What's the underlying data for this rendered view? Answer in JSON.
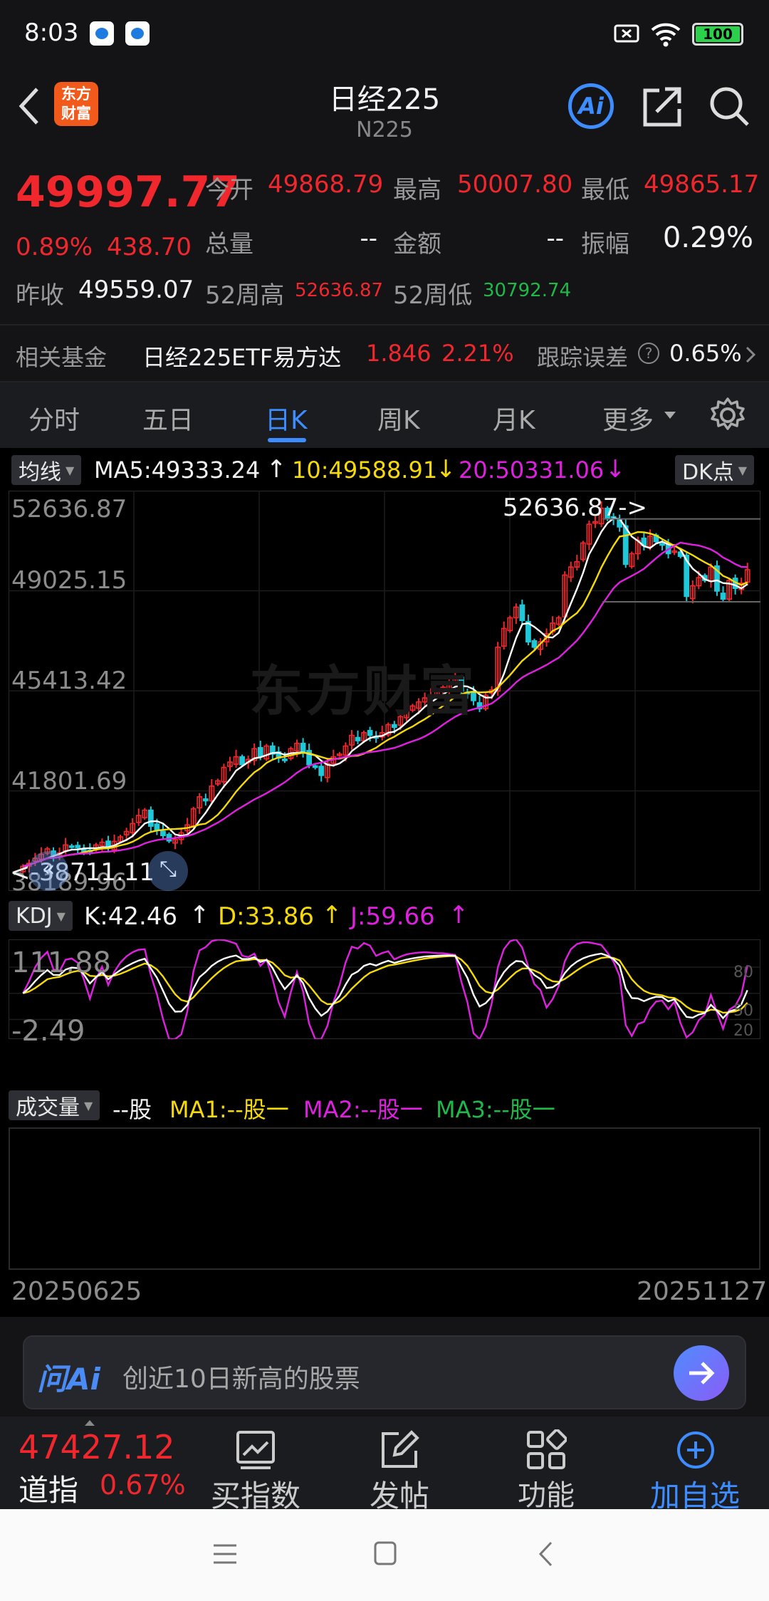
{
  "status": {
    "time": "8:03",
    "battery": "100"
  },
  "header": {
    "title": "日经225",
    "code": "N225",
    "logo_text": "东方\n财富",
    "ai_label": "Ai"
  },
  "quote": {
    "price": "49997.77",
    "change_pct": "0.89%",
    "change": "438.70",
    "open_label": "今开",
    "open": "49868.79",
    "high_label": "最高",
    "high": "50007.80",
    "low_label": "最低",
    "low": "49865.17",
    "volume_label": "总量",
    "volume": "--",
    "amount_label": "金额",
    "amount": "--",
    "amplitude_label": "振幅",
    "amplitude": "0.29%",
    "prev_label": "昨收",
    "prev": "49559.07",
    "w52h_label": "52周高",
    "w52h": "52636.87",
    "w52l_label": "52周低",
    "w52l": "30792.74"
  },
  "fund": {
    "label": "相关基金",
    "name": "日经225ETF易方达",
    "price": "1.846",
    "pct": "2.21%",
    "err_label": "跟踪误差",
    "err": "0.65%"
  },
  "tabs": [
    {
      "label": "分时"
    },
    {
      "label": "五日"
    },
    {
      "label": "日K"
    },
    {
      "label": "周K"
    },
    {
      "label": "月K"
    },
    {
      "label": "更多"
    }
  ],
  "ma_legend": {
    "btn": "均线",
    "ma5": "MA5:49333.24",
    "ma10": "10:49588.91",
    "ma20": "20:50331.06",
    "dk": "DK点"
  },
  "kline_axis": {
    "y1": "52636.87",
    "y2": "49025.15",
    "y3": "45413.42",
    "y4": "41801.69",
    "y5": "38189.96",
    "max_marker": "52636.87->",
    "min_marker": "<-38711.11",
    "watermark": "东方财富"
  },
  "kdj": {
    "btn": "KDJ",
    "k": "K:42.46",
    "d": "D:33.86",
    "j": "J:59.66",
    "top": "111.88",
    "bottom": "-2.49",
    "r80": "80",
    "r50": "50",
    "r20": "20"
  },
  "vol": {
    "btn": "成交量",
    "v": "--股",
    "ma1": "MA1:--股一",
    "ma2": "MA2:--股一",
    "ma3": "MA3:--股一"
  },
  "dates": {
    "start": "20250625",
    "end": "20251127"
  },
  "ask": {
    "logo": "问Ai",
    "placeholder": "创近10日新高的股票"
  },
  "tabbar": {
    "dow_price": "47427.12",
    "dow_label": "道指",
    "dow_pct": "0.67%",
    "buy": "买指数",
    "post": "发帖",
    "func": "功能",
    "add": "加自选"
  },
  "colors": {
    "up": "#f0282d",
    "down": "#1ec8d8",
    "ma5": "#ffffff",
    "ma10": "#f5d90a",
    "ma20": "#e020e0",
    "accent": "#2f7df6"
  },
  "icons": [
    "back-arrow-icon",
    "ai-icon",
    "share-icon",
    "search-icon",
    "settings-icon",
    "arrow-right-icon",
    "chart-icon",
    "edit-icon",
    "grid-icon",
    "plus-circle-icon"
  ],
  "chart_data": {
    "type": "candlestick",
    "close": [
      38900,
      39010,
      39200,
      39350,
      39550,
      39310,
      39400,
      39700,
      39640,
      39600,
      39500,
      39450,
      39700,
      39800,
      39600,
      39830,
      40000,
      40200,
      40500,
      40800,
      41000,
      40400,
      40250,
      40050,
      39850,
      39900,
      40150,
      40450,
      41050,
      41500,
      41350,
      41900,
      42100,
      42600,
      42800,
      43000,
      42700,
      42900,
      43300,
      43000,
      43400,
      43100,
      42950,
      42900,
      43300,
      43500,
      43150,
      42700,
      42600,
      42300,
      42750,
      43000,
      43100,
      43400,
      43800,
      43600,
      43900,
      43800,
      43700,
      43900,
      44200,
      44100,
      44500,
      44700,
      44900,
      45050,
      45200,
      45300,
      45500,
      45600,
      45800,
      45900,
      45450,
      45400,
      45100,
      44800,
      45300,
      45500,
      47100,
      47800,
      48200,
      48600,
      48100,
      47300,
      47100,
      47300,
      47600,
      48000,
      48200,
      49800,
      50100,
      50300,
      51000,
      51700,
      51800,
      52300,
      51900,
      51900,
      51600,
      50200,
      50600,
      51100,
      50900,
      51250,
      51050,
      50950,
      50600,
      50700,
      50500,
      49000,
      49400,
      49700,
      49600,
      50100,
      49200,
      48900,
      49600,
      49300,
      49500,
      49997.77
    ]
  }
}
